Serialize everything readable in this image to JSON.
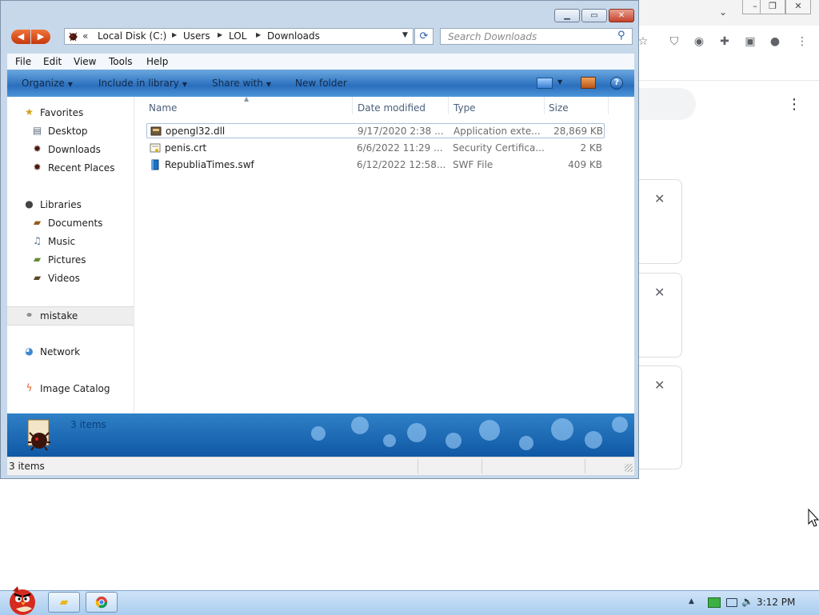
{
  "explorer": {
    "address": {
      "root_chevron": "«",
      "crumbs": [
        "Local Disk (C:)",
        "Users",
        "LOL",
        "Downloads"
      ]
    },
    "search_placeholder": "Search Downloads",
    "menu": [
      "File",
      "Edit",
      "View",
      "Tools",
      "Help"
    ],
    "commands": {
      "organize": "Organize",
      "include": "Include in library",
      "share": "Share with",
      "new_folder": "New folder"
    },
    "nav": {
      "favorites": "Favorites",
      "desktop": "Desktop",
      "downloads": "Downloads",
      "recent": "Recent Places",
      "libraries": "Libraries",
      "documents": "Documents",
      "music": "Music",
      "pictures": "Pictures",
      "videos": "Videos",
      "mistake": "mistake",
      "network": "Network",
      "image_catalog": "Image Catalog"
    },
    "columns": {
      "name": "Name",
      "date": "Date modified",
      "type": "Type",
      "size": "Size"
    },
    "files": [
      {
        "name": "opengl32.dll",
        "date": "9/17/2020 2:38 ...",
        "type": "Application exte...",
        "size": "28,869 KB",
        "icon": "dll-icon"
      },
      {
        "name": "penis.crt",
        "date": "6/6/2022 11:29 ...",
        "type": "Security Certifica...",
        "size": "2 KB",
        "icon": "certificate-icon"
      },
      {
        "name": "RepubliaTimes.swf",
        "date": "6/12/2022 12:58...",
        "type": "SWF File",
        "size": "409 KB",
        "icon": "swf-file-icon"
      }
    ],
    "details_count": "3 items",
    "status": "3 items"
  },
  "taskbar": {
    "clock": "3:12 PM"
  },
  "colors": {
    "command_bar": "#2a6fbe",
    "details_pane": "#0f58a5",
    "nav_back": "#c7380c",
    "taskbar": "#a9cdef"
  }
}
